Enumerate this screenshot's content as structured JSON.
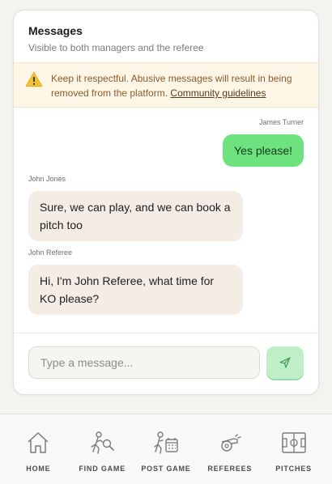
{
  "messages_panel": {
    "title": "Messages",
    "subtitle": "Visible to both managers and the referee"
  },
  "warning": {
    "icon": "warning-triangle-icon",
    "text": "Keep it respectful. Abusive messages will result in being removed from the platform.",
    "link_text": "Community guidelines"
  },
  "thread": {
    "messages": [
      {
        "sender": "James Turner",
        "text": "Yes please!",
        "direction": "outgoing"
      },
      {
        "sender": "John Jones",
        "text": "Sure, we can play, and we can book a pitch too",
        "direction": "incoming"
      },
      {
        "sender": "John Referee",
        "text": "Hi, I'm John Referee, what time for KO please?",
        "direction": "incoming"
      }
    ]
  },
  "composer": {
    "placeholder": "Type a message...",
    "send_icon": "send-icon"
  },
  "nav": {
    "items": [
      {
        "label": "HOME",
        "icon": "home-icon"
      },
      {
        "label": "FIND GAME",
        "icon": "find-game-icon"
      },
      {
        "label": "POST GAME",
        "icon": "post-game-icon"
      },
      {
        "label": "REFEREES",
        "icon": "whistle-icon"
      },
      {
        "label": "PITCHES",
        "icon": "pitch-icon"
      }
    ]
  },
  "colors": {
    "outgoing_bubble": "#6ee27f",
    "incoming_bubble": "#f3ede5",
    "warning_bg": "#fdf6e6",
    "send_button": "#bfefc6"
  }
}
